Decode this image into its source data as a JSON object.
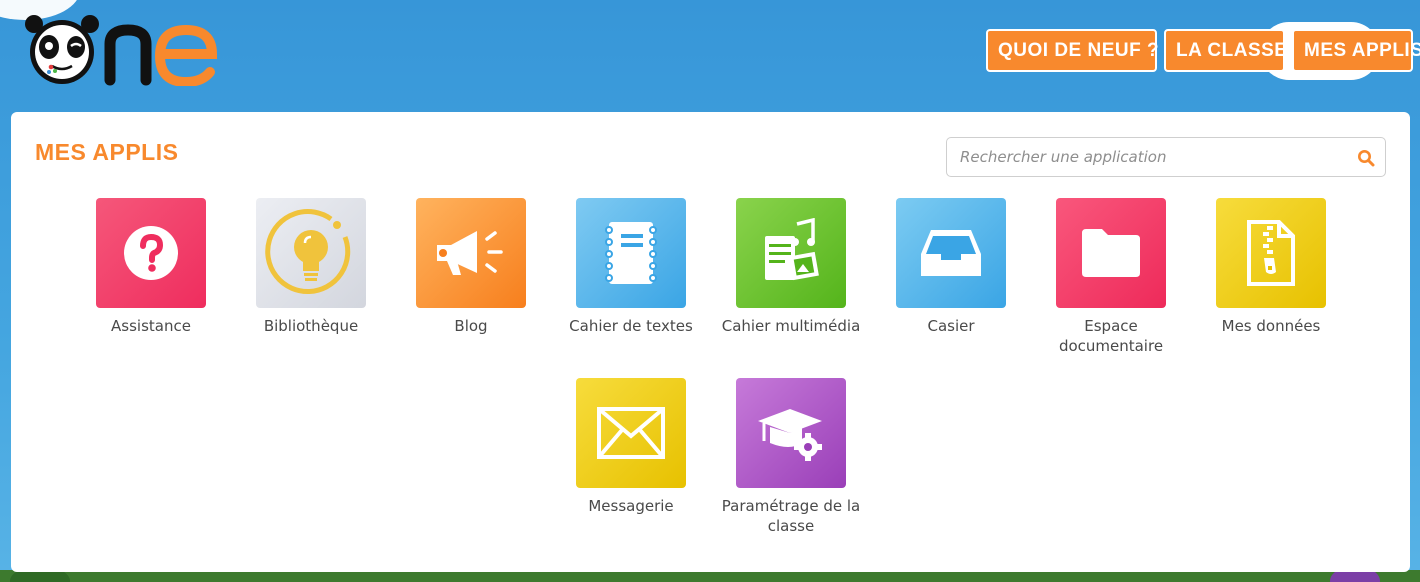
{
  "header": {
    "logo_text": "One",
    "nav": [
      {
        "label": "QUOI DE NEUF ?"
      },
      {
        "label": "LA CLASSE"
      },
      {
        "label": "MES APPLIS"
      }
    ]
  },
  "main": {
    "title": "MES APPLIS",
    "search": {
      "placeholder": "Rechercher une application",
      "icon": "search-icon"
    },
    "apps": [
      {
        "label": "Assistance",
        "icon": "question-icon",
        "color": "#ef2d5e"
      },
      {
        "label": "Bibliothèque",
        "icon": "lightbulb-icon",
        "color": "#d3d6de"
      },
      {
        "label": "Blog",
        "icon": "megaphone-icon",
        "color": "#f77f1d"
      },
      {
        "label": "Cahier de textes",
        "icon": "notebook-icon",
        "color": "#3aa5e5"
      },
      {
        "label": "Cahier multimédia",
        "icon": "multimedia-notebook-icon",
        "color": "#54b41b"
      },
      {
        "label": "Casier",
        "icon": "inbox-tray-icon",
        "color": "#3aa5e5"
      },
      {
        "label": "Espace documentaire",
        "icon": "folder-icon",
        "color": "#ee2a5a"
      },
      {
        "label": "Mes données",
        "icon": "zip-file-icon",
        "color": "#e7c100"
      },
      {
        "label": "Messagerie",
        "icon": "envelope-icon",
        "color": "#e7c100"
      },
      {
        "label": "Paramétrage de la classe",
        "icon": "graduation-cap-gear-icon",
        "color": "#9a3fb8"
      }
    ]
  },
  "colors": {
    "accent": "#f8892d",
    "background": "#3796d8",
    "panel": "#ffffff"
  }
}
